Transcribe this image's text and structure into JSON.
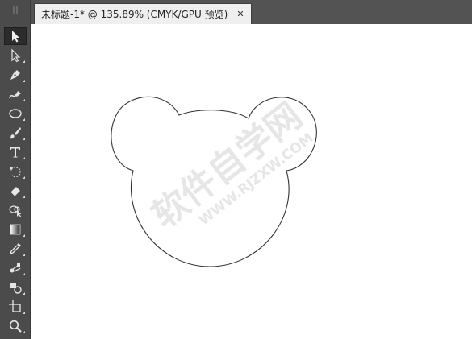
{
  "document_tab": {
    "title": "未标题-1* @ 135.89% (CMYK/GPU 预览)",
    "close_glyph": "✕"
  },
  "toolbar": {
    "tools": [
      {
        "name": "selection-tool",
        "icon": "arrow-icon",
        "active": true
      },
      {
        "name": "direct-selection-tool",
        "icon": "hollow-arrow-icon"
      },
      {
        "name": "pen-tool",
        "icon": "pen-icon"
      },
      {
        "name": "curvature-tool",
        "icon": "curvature-pen-icon"
      },
      {
        "name": "ellipse-tool",
        "icon": "ellipse-icon"
      },
      {
        "name": "paintbrush-tool",
        "icon": "brush-icon"
      },
      {
        "name": "type-tool",
        "icon": "type-icon"
      },
      {
        "name": "rotate-tool",
        "icon": "rotate-icon"
      },
      {
        "name": "eraser-tool",
        "icon": "eraser-icon"
      },
      {
        "name": "shape-builder-tool",
        "icon": "shape-builder-icon"
      },
      {
        "name": "gradient-tool",
        "icon": "gradient-icon"
      },
      {
        "name": "eyedropper-tool",
        "icon": "eyedropper-icon"
      },
      {
        "name": "blend-tool",
        "icon": "blend-icon"
      },
      {
        "name": "live-paint-tool",
        "icon": "live-paint-icon"
      },
      {
        "name": "artboard-tool",
        "icon": "artboard-icon"
      },
      {
        "name": "zoom-tool",
        "icon": "zoom-icon"
      }
    ]
  },
  "canvas": {
    "artwork": "bear-head-outline",
    "watermark_main": "软件自学网",
    "watermark_sub": "WWW.RJZXW.COM"
  },
  "colors": {
    "toolbar_bg": "#4b4b4b",
    "tab_bg": "#efefef",
    "canvas_bg": "#ffffff",
    "stroke": "#333333",
    "watermark": "#e4e4e4"
  }
}
